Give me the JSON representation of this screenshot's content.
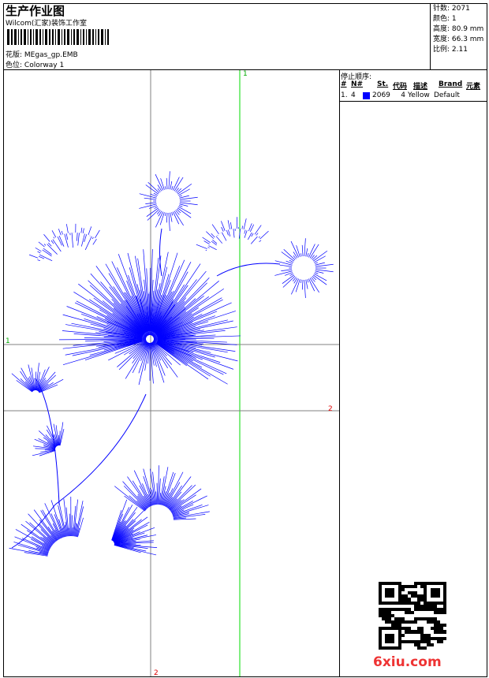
{
  "header": {
    "title": "生产作业图",
    "company": "Wilcom(汇家)装饰工作室",
    "design_label": "花版:",
    "design_value": "MEgas_gp.EMB",
    "colorway_label": "色位:",
    "colorway_value": "Colorway 1"
  },
  "info": {
    "stitches": "针数: 2071",
    "colors": "颜色: 1",
    "height": "高度: 80.9 mm",
    "width": "宽度: 66.3 mm",
    "scale": "比例: 2.11"
  },
  "stop_sequence": {
    "title": "停止顺序:",
    "columns": [
      "#",
      "N#",
      "St.",
      "代码",
      "描述",
      "Brand",
      "元素"
    ],
    "rows": [
      {
        "index": "1.",
        "needle": "4",
        "color": "#0000ff",
        "stitches": "2069",
        "code": "4",
        "desc": "Yellow",
        "brand": "Default"
      }
    ]
  },
  "guides": {
    "v1": "1",
    "v2": "2",
    "h1": "1",
    "h2": "2"
  },
  "colors": {
    "thread": "#0000ff",
    "guide_green": "#00dd00",
    "guide_grey": "#808080",
    "marker_red": "#dd0000"
  },
  "watermark": "6xiu.com"
}
